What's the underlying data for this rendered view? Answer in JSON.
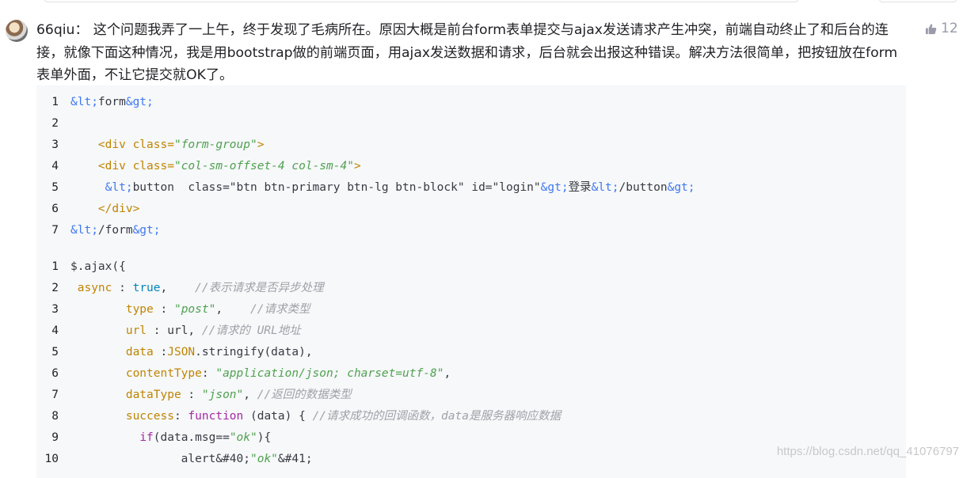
{
  "comment": {
    "author": "66qiu：",
    "text": "这个问题我弄了一上午，终于发现了毛病所在。原因大概是前台form表单提交与ajax发送请求产生冲突，前端自动终止了和后台的连接，就像下面这种情况，我是用bootstrap做的前端页面，用ajax发送数据和请求，后台就会出报这种错误。解决方法很简单，把按钮放在form表单外面，不让它提交就OK了。",
    "likes": "12"
  },
  "code1": [
    {
      "n": "1",
      "parts": [
        [
          "ent",
          "&lt;"
        ],
        [
          "",
          "form"
        ],
        [
          "ent",
          "&gt;"
        ]
      ]
    },
    {
      "n": "2",
      "parts": []
    },
    {
      "n": "3",
      "parts": [
        [
          "",
          "    "
        ],
        [
          "k",
          "<div "
        ],
        [
          "k",
          "class="
        ],
        [
          "str",
          "\"form-group\""
        ],
        [
          "k",
          ">"
        ]
      ]
    },
    {
      "n": "4",
      "parts": [
        [
          "",
          "    "
        ],
        [
          "k",
          "<div "
        ],
        [
          "k",
          "class="
        ],
        [
          "str",
          "\"col-sm-offset-4 col-sm-4\""
        ],
        [
          "k",
          ">"
        ]
      ]
    },
    {
      "n": "5",
      "parts": [
        [
          "",
          "     "
        ],
        [
          "ent",
          "&lt;"
        ],
        [
          "",
          "button  class=\"btn btn-primary btn-lg btn-block\" id=\"login\""
        ],
        [
          "ent",
          "&gt;"
        ],
        [
          "",
          "登录"
        ],
        [
          "ent",
          "&lt;"
        ],
        [
          "",
          "/button"
        ],
        [
          "ent",
          "&gt;"
        ]
      ]
    },
    {
      "n": "6",
      "parts": [
        [
          "",
          "    "
        ],
        [
          "k",
          "</div>"
        ]
      ]
    },
    {
      "n": "7",
      "parts": [
        [
          "ent",
          "&lt;"
        ],
        [
          "",
          "/form"
        ],
        [
          "ent",
          "&gt;"
        ]
      ]
    }
  ],
  "code2": [
    {
      "n": "1",
      "parts": [
        [
          "",
          "$.ajax({"
        ]
      ]
    },
    {
      "n": "2",
      "parts": [
        [
          "k",
          " async"
        ],
        [
          "",
          " : "
        ],
        [
          "bool",
          "true"
        ],
        [
          "",
          ",    "
        ],
        [
          "cm",
          "//表示请求是否异步处理"
        ]
      ]
    },
    {
      "n": "3",
      "parts": [
        [
          "",
          "        "
        ],
        [
          "k",
          "type"
        ],
        [
          "",
          " : "
        ],
        [
          "str",
          "\"post\""
        ],
        [
          "",
          ",    "
        ],
        [
          "cm",
          "//请求类型"
        ]
      ]
    },
    {
      "n": "4",
      "parts": [
        [
          "",
          "        "
        ],
        [
          "k",
          "url"
        ],
        [
          "",
          " : url, "
        ],
        [
          "cm",
          "//请求的 URL地址"
        ]
      ]
    },
    {
      "n": "5",
      "parts": [
        [
          "",
          "        "
        ],
        [
          "k",
          "data"
        ],
        [
          "",
          " :"
        ],
        [
          "k",
          "JSON"
        ],
        [
          "",
          ".stringify(data),"
        ]
      ]
    },
    {
      "n": "6",
      "parts": [
        [
          "",
          "        "
        ],
        [
          "k",
          "contentType"
        ],
        [
          "",
          ": "
        ],
        [
          "str",
          "\"application/json; charset=utf-8\""
        ],
        [
          "",
          ","
        ]
      ]
    },
    {
      "n": "7",
      "parts": [
        [
          "",
          "        "
        ],
        [
          "k",
          "dataType"
        ],
        [
          "",
          " : "
        ],
        [
          "str",
          "\"json\""
        ],
        [
          "",
          ", "
        ],
        [
          "cm",
          "//返回的数据类型"
        ]
      ]
    },
    {
      "n": "8",
      "parts": [
        [
          "",
          "        "
        ],
        [
          "k",
          "success"
        ],
        [
          "",
          ": "
        ],
        [
          "kw",
          "function"
        ],
        [
          "",
          " (data) { "
        ],
        [
          "cm",
          "//请求成功的回调函数，data是服务器响应数据"
        ]
      ]
    },
    {
      "n": "9",
      "parts": [
        [
          "",
          "          "
        ],
        [
          "kw",
          "if"
        ],
        [
          "",
          "(data.msg=="
        ],
        [
          "str",
          "\"ok\""
        ],
        [
          "",
          "){"
        ]
      ]
    },
    {
      "n": "10",
      "parts": [
        [
          "",
          "                alert&#40;"
        ],
        [
          "str",
          "\"ok\""
        ],
        [
          "",
          "&#41;"
        ]
      ]
    }
  ],
  "watermark": "https://blog.csdn.net/qq_41076797",
  "colors": {
    "code_bg": "#f6f8fa",
    "string": "#50a14f",
    "keyword_attr": "#c18401",
    "entity": "#4078f2",
    "comment": "#a0a1a7",
    "muted": "#999aaa"
  },
  "icons": {
    "avatar": "avatar-image",
    "like": "thumbs-up-icon"
  }
}
